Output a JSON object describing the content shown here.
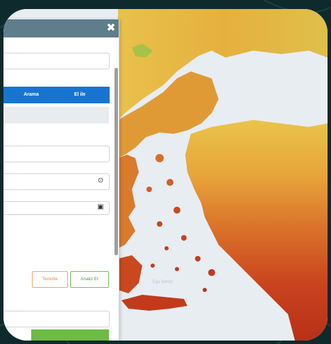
{
  "panel": {
    "close_label": "✖",
    "tabs": [
      {
        "label": "Arama"
      },
      {
        "label": "El ile"
      }
    ],
    "time_icon": "clock-icon",
    "calendar_icon": "calendar-icon",
    "reset_button": "Temizle",
    "analyze_button": "Analiz Et"
  },
  "map": {
    "sea_label": "Ege Denizi"
  },
  "colors": {
    "header": "#607d8b",
    "tab_active": "#1675d1",
    "reset": "#e8833a",
    "analyze": "#4ca33a",
    "sea": "#e8edf2"
  }
}
